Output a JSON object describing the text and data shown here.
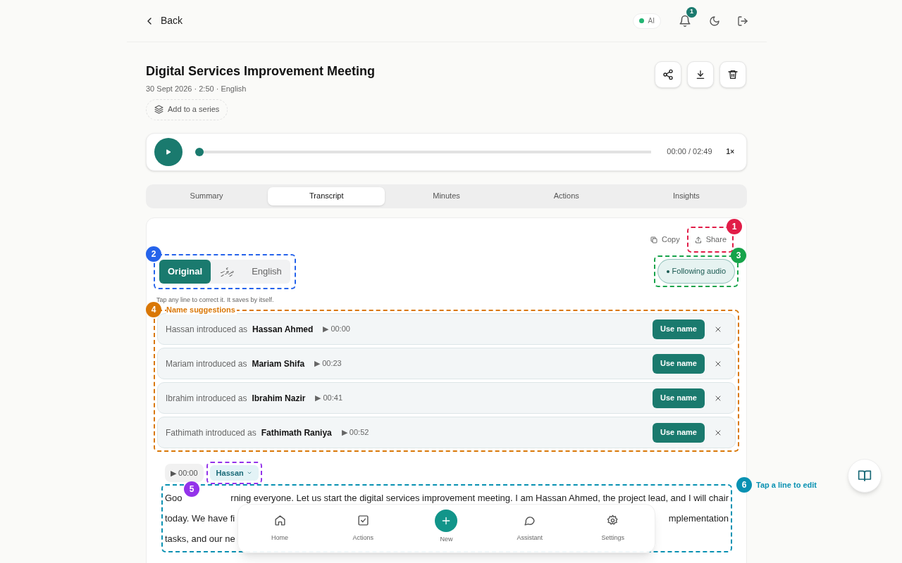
{
  "header": {
    "back": "Back",
    "ai_status": {
      "label": "AI",
      "on": true
    },
    "notifications": "1"
  },
  "meeting": {
    "title": "Digital Services Improvement Meeting",
    "meta": "30 Sept 2026 · 2:50 · English",
    "series_button": "Add to a series"
  },
  "player": {
    "level": 0,
    "time": "00:00 / 02:49",
    "speed": "1×"
  },
  "tabs": [
    {
      "label": "Summary",
      "selected": false
    },
    {
      "label": "Transcript",
      "selected": true
    },
    {
      "label": "Minutes",
      "selected": false
    },
    {
      "label": "Actions",
      "selected": false
    },
    {
      "label": "Insights",
      "selected": false
    }
  ],
  "transcript": {
    "copy": "Copy",
    "share": "Share",
    "languages": [
      {
        "label": "Original",
        "selected": true
      },
      {
        "label": "ދިވެހި",
        "selected": false
      },
      {
        "label": "English",
        "selected": false
      }
    ],
    "following_audio": {
      "label": "Following audio",
      "on": true
    },
    "hint": "Tap any line to correct it. It saves by itself.",
    "name_suggestions_label": "Name suggestions",
    "name_suggestions": [
      {
        "speaker": "Hassan introduced as",
        "name": "Hassan Ahmed",
        "time": "▶ 00:00",
        "button": "Use name"
      },
      {
        "speaker": "Mariam introduced as",
        "name": "Mariam Shifa",
        "time": "▶ 00:23",
        "button": "Use name"
      },
      {
        "speaker": "Ibrahim introduced as",
        "name": "Ibrahim Nazir",
        "time": "▶ 00:41",
        "button": "Use name"
      },
      {
        "speaker": "Fathimath introduced as",
        "name": "Fathimath Raniya",
        "time": "▶ 00:52",
        "button": "Use name"
      }
    ],
    "line": {
      "time": "▶ 00:00",
      "speaker": "Hassan",
      "text_lines": [
        [
          "Goo",
          "rning everyone. Let us start the digital services improvement meeting. I am Hassan Ahmed, the project lead, and I will chair"
        ],
        [
          "today. We have fi",
          "mplementation"
        ],
        [
          "tasks, and our ne"
        ]
      ]
    }
  },
  "annotations": [
    {
      "number": "1",
      "color": "#e11d48"
    },
    {
      "number": "2",
      "color": "#2563eb"
    },
    {
      "number": "3",
      "color": "#16a34a"
    },
    {
      "number": "4",
      "color": "#d97706"
    },
    {
      "number": "5",
      "color": "#9333ea"
    },
    {
      "number": "6",
      "color": "#0891b2",
      "label": "Tap a line to edit"
    }
  ],
  "bottom_nav": [
    {
      "label": "Home",
      "kind": "home"
    },
    {
      "label": "Actions",
      "kind": "check"
    },
    {
      "label": "New",
      "kind": "plus"
    },
    {
      "label": "Assistant",
      "kind": "chat"
    },
    {
      "label": "Settings",
      "kind": "gear"
    }
  ]
}
